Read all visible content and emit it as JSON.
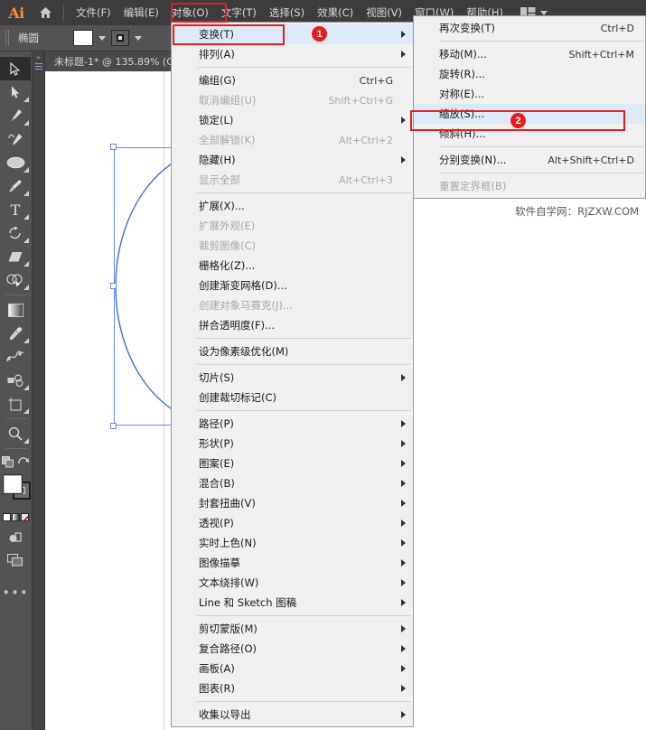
{
  "app": {
    "logo": "Ai",
    "home_icon": "home-icon",
    "workspace_icon": "workspace-layout-icon",
    "workspace_chevron": "chevron-down-icon"
  },
  "menubar": {
    "items": [
      {
        "label": "文件(F)",
        "active": false
      },
      {
        "label": "编辑(E)",
        "active": false
      },
      {
        "label": "对象(O)",
        "active": true
      },
      {
        "label": "文字(T)",
        "active": false
      },
      {
        "label": "选择(S)",
        "active": false
      },
      {
        "label": "效果(C)",
        "active": false
      },
      {
        "label": "视图(V)",
        "active": false
      },
      {
        "label": "窗口(W)",
        "active": false
      },
      {
        "label": "帮助(H)",
        "active": false
      }
    ]
  },
  "optionsbar": {
    "tool_name": "椭圆",
    "fill_swatch": "#ffffff",
    "fill_chevron": "chevron-down-icon",
    "stroke_swatch": "stroke-square-icon",
    "stroke_chevron": "chevron-down-icon"
  },
  "toolbar": {
    "tools": [
      {
        "name": "selection-tool",
        "icon": "arrow-cursor-icon",
        "selected": true,
        "flyout": false
      },
      {
        "name": "direct-selection-tool",
        "icon": "white-arrow-icon",
        "selected": false,
        "flyout": true
      },
      {
        "name": "pen-tool",
        "icon": "pen-icon",
        "selected": false,
        "flyout": true
      },
      {
        "name": "curvature-tool",
        "icon": "curvature-pen-icon",
        "selected": false,
        "flyout": false
      },
      {
        "name": "ellipse-tool",
        "icon": "ellipse-icon",
        "selected": false,
        "flyout": true
      },
      {
        "name": "paintbrush-tool",
        "icon": "paintbrush-icon",
        "selected": false,
        "flyout": true
      },
      {
        "name": "type-tool",
        "icon": "type-t-icon",
        "selected": false,
        "flyout": true
      },
      {
        "name": "rotate-tool",
        "icon": "rotate-icon",
        "selected": false,
        "flyout": true
      },
      {
        "name": "eraser-tool",
        "icon": "eraser-icon",
        "selected": false,
        "flyout": true
      },
      {
        "name": "shape-builder-tool",
        "icon": "shape-builder-icon",
        "selected": false,
        "flyout": true
      },
      {
        "name": "gradient-tool",
        "icon": "gradient-icon",
        "selected": false,
        "flyout": false
      },
      {
        "name": "eyedropper-tool",
        "icon": "eyedropper-icon",
        "selected": false,
        "flyout": true
      },
      {
        "name": "blend-tool",
        "icon": "blend-icon",
        "selected": false,
        "flyout": false
      },
      {
        "name": "symbol-sprayer-tool",
        "icon": "symbol-sprayer-icon",
        "selected": false,
        "flyout": true
      },
      {
        "name": "artboard-tool",
        "icon": "artboard-icon",
        "selected": false,
        "flyout": true
      },
      {
        "name": "zoom-tool",
        "icon": "magnifier-icon",
        "selected": false,
        "flyout": true
      }
    ],
    "extras": {
      "drawing_modes_icon": "drawing-modes-icon",
      "screen_mode_icon": "change-screen-mode-icon",
      "fill_color": "#ffffff",
      "stroke_color": "#1c1c1c",
      "color_none_icon": "none-slash-icon",
      "edit_toolbar_icon": "ellipsis-icon"
    }
  },
  "document": {
    "tab_title": "未标题-1* @ 135.89% (C",
    "panel_handle_icon": "expand-panels-icon"
  },
  "canvas": {
    "selection": {
      "shape": "ellipse",
      "stroke_color": "#3b6fd4",
      "bbox_color": "#5c8cf0"
    }
  },
  "object_menu": {
    "items": [
      {
        "label": "变换(T)",
        "accel": "",
        "submenu": true,
        "disabled": false,
        "highlight": true,
        "sep_after": false
      },
      {
        "label": "排列(A)",
        "accel": "",
        "submenu": true,
        "disabled": false,
        "highlight": false,
        "sep_after": true
      },
      {
        "label": "编组(G)",
        "accel": "Ctrl+G",
        "submenu": false,
        "disabled": false,
        "highlight": false,
        "sep_after": false
      },
      {
        "label": "取消编组(U)",
        "accel": "Shift+Ctrl+G",
        "submenu": false,
        "disabled": true,
        "highlight": false,
        "sep_after": false
      },
      {
        "label": "锁定(L)",
        "accel": "",
        "submenu": true,
        "disabled": false,
        "highlight": false,
        "sep_after": false
      },
      {
        "label": "全部解锁(K)",
        "accel": "Alt+Ctrl+2",
        "submenu": false,
        "disabled": true,
        "highlight": false,
        "sep_after": false
      },
      {
        "label": "隐藏(H)",
        "accel": "",
        "submenu": true,
        "disabled": false,
        "highlight": false,
        "sep_after": false
      },
      {
        "label": "显示全部",
        "accel": "Alt+Ctrl+3",
        "submenu": false,
        "disabled": true,
        "highlight": false,
        "sep_after": true
      },
      {
        "label": "扩展(X)...",
        "accel": "",
        "submenu": false,
        "disabled": false,
        "highlight": false,
        "sep_after": false
      },
      {
        "label": "扩展外观(E)",
        "accel": "",
        "submenu": false,
        "disabled": true,
        "highlight": false,
        "sep_after": false
      },
      {
        "label": "裁剪图像(C)",
        "accel": "",
        "submenu": false,
        "disabled": true,
        "highlight": false,
        "sep_after": false
      },
      {
        "label": "栅格化(Z)...",
        "accel": "",
        "submenu": false,
        "disabled": false,
        "highlight": false,
        "sep_after": false
      },
      {
        "label": "创建渐变网格(D)...",
        "accel": "",
        "submenu": false,
        "disabled": false,
        "highlight": false,
        "sep_after": false
      },
      {
        "label": "创建对象马赛克(J)...",
        "accel": "",
        "submenu": false,
        "disabled": true,
        "highlight": false,
        "sep_after": false
      },
      {
        "label": "拼合透明度(F)...",
        "accel": "",
        "submenu": false,
        "disabled": false,
        "highlight": false,
        "sep_after": true
      },
      {
        "label": "设为像素级优化(M)",
        "accel": "",
        "submenu": false,
        "disabled": false,
        "highlight": false,
        "sep_after": true
      },
      {
        "label": "切片(S)",
        "accel": "",
        "submenu": true,
        "disabled": false,
        "highlight": false,
        "sep_after": false
      },
      {
        "label": "创建裁切标记(C)",
        "accel": "",
        "submenu": false,
        "disabled": false,
        "highlight": false,
        "sep_after": true
      },
      {
        "label": "路径(P)",
        "accel": "",
        "submenu": true,
        "disabled": false,
        "highlight": false,
        "sep_after": false
      },
      {
        "label": "形状(P)",
        "accel": "",
        "submenu": true,
        "disabled": false,
        "highlight": false,
        "sep_after": false
      },
      {
        "label": "图案(E)",
        "accel": "",
        "submenu": true,
        "disabled": false,
        "highlight": false,
        "sep_after": false
      },
      {
        "label": "混合(B)",
        "accel": "",
        "submenu": true,
        "disabled": false,
        "highlight": false,
        "sep_after": false
      },
      {
        "label": "封套扭曲(V)",
        "accel": "",
        "submenu": true,
        "disabled": false,
        "highlight": false,
        "sep_after": false
      },
      {
        "label": "透视(P)",
        "accel": "",
        "submenu": true,
        "disabled": false,
        "highlight": false,
        "sep_after": false
      },
      {
        "label": "实时上色(N)",
        "accel": "",
        "submenu": true,
        "disabled": false,
        "highlight": false,
        "sep_after": false
      },
      {
        "label": "图像描摹",
        "accel": "",
        "submenu": true,
        "disabled": false,
        "highlight": false,
        "sep_after": false
      },
      {
        "label": "文本绕排(W)",
        "accel": "",
        "submenu": true,
        "disabled": false,
        "highlight": false,
        "sep_after": false
      },
      {
        "label": "Line 和 Sketch 图稿",
        "accel": "",
        "submenu": true,
        "disabled": false,
        "highlight": false,
        "sep_after": true
      },
      {
        "label": "剪切蒙版(M)",
        "accel": "",
        "submenu": true,
        "disabled": false,
        "highlight": false,
        "sep_after": false
      },
      {
        "label": "复合路径(O)",
        "accel": "",
        "submenu": true,
        "disabled": false,
        "highlight": false,
        "sep_after": false
      },
      {
        "label": "画板(A)",
        "accel": "",
        "submenu": true,
        "disabled": false,
        "highlight": false,
        "sep_after": false
      },
      {
        "label": "图表(R)",
        "accel": "",
        "submenu": true,
        "disabled": false,
        "highlight": false,
        "sep_after": true
      },
      {
        "label": "收集以导出",
        "accel": "",
        "submenu": true,
        "disabled": false,
        "highlight": false,
        "sep_after": false
      }
    ]
  },
  "transform_submenu": {
    "items": [
      {
        "label": "再次变换(T)",
        "accel": "Ctrl+D",
        "submenu": false,
        "disabled": false,
        "highlight": false,
        "sep_after": true
      },
      {
        "label": "移动(M)...",
        "accel": "Shift+Ctrl+M",
        "submenu": false,
        "disabled": false,
        "highlight": false,
        "sep_after": false
      },
      {
        "label": "旋转(R)...",
        "accel": "",
        "submenu": false,
        "disabled": false,
        "highlight": false,
        "sep_after": false
      },
      {
        "label": "对称(E)...",
        "accel": "",
        "submenu": false,
        "disabled": false,
        "highlight": false,
        "sep_after": false
      },
      {
        "label": "缩放(S)...",
        "accel": "",
        "submenu": false,
        "disabled": false,
        "highlight": true,
        "sep_after": false
      },
      {
        "label": "倾斜(H)...",
        "accel": "",
        "submenu": false,
        "disabled": false,
        "highlight": false,
        "sep_after": true
      },
      {
        "label": "分别变换(N)...",
        "accel": "Alt+Shift+Ctrl+D",
        "submenu": false,
        "disabled": false,
        "highlight": false,
        "sep_after": true
      },
      {
        "label": "重置定界框(B)",
        "accel": "",
        "submenu": false,
        "disabled": true,
        "highlight": false,
        "sep_after": false
      }
    ]
  },
  "annotations": {
    "accent_color": "#e81c1c",
    "badges": [
      {
        "number": "1"
      },
      {
        "number": "2"
      }
    ]
  },
  "watermark": {
    "text": "软件自学网：RJZXW.COM"
  }
}
